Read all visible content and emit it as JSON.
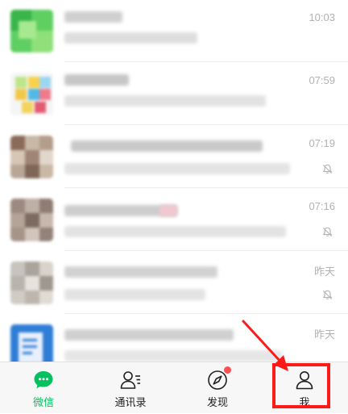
{
  "chats": [
    {
      "time": "10:03",
      "muted": false
    },
    {
      "time": "07:59",
      "muted": false
    },
    {
      "time": "07:19",
      "muted": true
    },
    {
      "time": "07:16",
      "muted": true
    },
    {
      "time": "昨天",
      "muted": true
    },
    {
      "time": "昨天",
      "muted": false
    }
  ],
  "tabs": [
    {
      "label": "微信",
      "icon": "chat-bubble-icon",
      "active": true
    },
    {
      "label": "通讯录",
      "icon": "contacts-icon",
      "active": false
    },
    {
      "label": "发现",
      "icon": "compass-icon",
      "active": false,
      "badge": true
    },
    {
      "label": "我",
      "icon": "person-icon",
      "active": false
    }
  ],
  "colors": {
    "accent": "#07c160",
    "highlight": "#ff1a1a",
    "badge": "#fa5151"
  }
}
